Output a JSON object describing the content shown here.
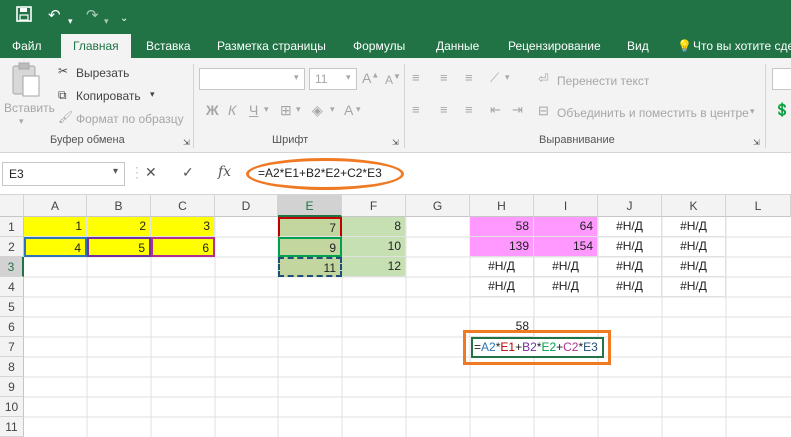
{
  "quick_access": {
    "save_icon": "save-icon",
    "undo_icon": "undo-icon",
    "redo_icon": "redo-icon",
    "customize_icon": "customize-icon"
  },
  "tabs": [
    {
      "label": "Файл"
    },
    {
      "label": "Главная"
    },
    {
      "label": "Вставка"
    },
    {
      "label": "Разметка страницы"
    },
    {
      "label": "Формулы"
    },
    {
      "label": "Данные"
    },
    {
      "label": "Рецензирование"
    },
    {
      "label": "Вид"
    }
  ],
  "tell_me": "Что вы хотите сде",
  "clipboard": {
    "paste": "Вставить",
    "cut": "Вырезать",
    "copy": "Копировать",
    "format_painter": "Формат по образцу",
    "group": "Буфер обмена"
  },
  "font": {
    "size": "11",
    "bold": "Ж",
    "italic": "К",
    "underline": "Ч",
    "group": "Шрифт"
  },
  "alignment": {
    "wrap": "Перенести текст",
    "merge": "Объединить и поместить в центре",
    "group": "Выравнивание"
  },
  "formula_bar": {
    "name_box": "E3",
    "fx": "fx",
    "formula": "=A2*E1+B2*E2+C2*E3"
  },
  "columns": [
    "A",
    "B",
    "C",
    "D",
    "E",
    "F",
    "G",
    "H",
    "I",
    "J",
    "K",
    "L"
  ],
  "rows": [
    "1",
    "2",
    "3",
    "4",
    "5",
    "6",
    "7",
    "8",
    "9",
    "10",
    "11"
  ],
  "cells": {
    "A1": "1",
    "B1": "2",
    "C1": "3",
    "A2": "4",
    "B2": "5",
    "C2": "6",
    "E1": "7",
    "F1": "8",
    "E2": "9",
    "F2": "10",
    "E3": "11",
    "F3": "12",
    "H1": "58",
    "I1": "64",
    "J1": "#Н/Д",
    "K1": "#Н/Д",
    "H2": "139",
    "I2": "154",
    "J2": "#Н/Д",
    "K2": "#Н/Д",
    "H3": "#Н/Д",
    "I3": "#Н/Д",
    "J3": "#Н/Д",
    "K3": "#Н/Д",
    "H4": "#Н/Д",
    "I4": "#Н/Д",
    "J4": "#Н/Д",
    "K4": "#Н/Д",
    "H6": "58"
  },
  "edit_formula_parts": [
    {
      "text": "=",
      "color": "#222222"
    },
    {
      "text": "A2",
      "color": "#2e75b6"
    },
    {
      "text": "*",
      "color": "#222222"
    },
    {
      "text": "E1",
      "color": "#c00000"
    },
    {
      "text": "+",
      "color": "#222222"
    },
    {
      "text": "B2",
      "color": "#7030a0"
    },
    {
      "text": "*",
      "color": "#222222"
    },
    {
      "text": "E2",
      "color": "#00a050"
    },
    {
      "text": "+",
      "color": "#222222"
    },
    {
      "text": "C2",
      "color": "#b03090"
    },
    {
      "text": "*",
      "color": "#222222"
    },
    {
      "text": "E3",
      "color": "#1f4e79"
    }
  ],
  "colors": {
    "excel_green": "#217346",
    "highlight_orange": "#f07a24",
    "yellow": "#ffff00",
    "green_fill": "#c6e0b4",
    "pink_fill": "#ff99ff"
  }
}
